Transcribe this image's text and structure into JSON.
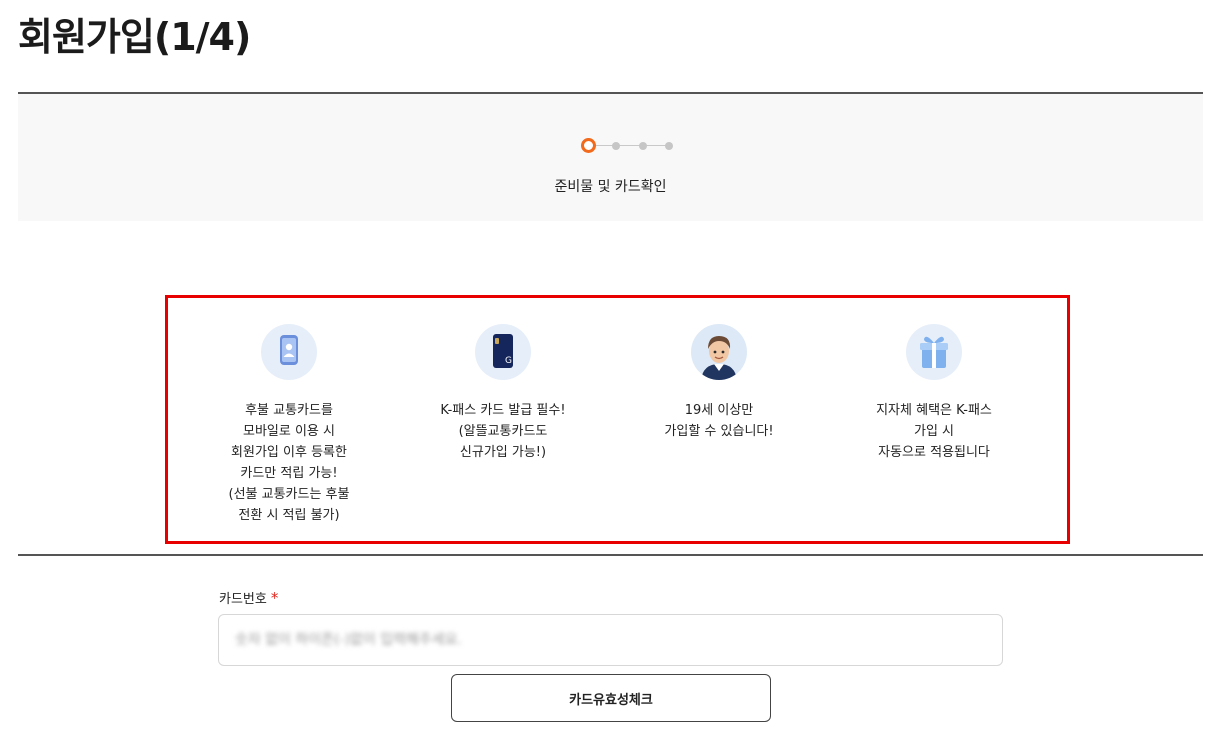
{
  "page": {
    "title": "회원가입(1/4)"
  },
  "stepper": {
    "total_steps": 4,
    "current_step": 1,
    "current_label": "준비물 및 카드확인"
  },
  "notices": [
    {
      "icon": "smartphone-icon",
      "lines": [
        "후불 교통카드를",
        "모바일로 이용 시",
        "회원가입 이후 등록한",
        "카드만 적립 가능!",
        "(선불 교통카드는 후불",
        "전환 시 적립 불가)"
      ]
    },
    {
      "icon": "transit-card-icon",
      "lines": [
        "K-패스 카드 발급 필수!",
        "(알뜰교통카드도",
        "신규가입 가능!)"
      ]
    },
    {
      "icon": "person-avatar-icon",
      "lines": [
        "19세 이상만",
        "가입할 수 있습니다!"
      ]
    },
    {
      "icon": "gift-box-icon",
      "lines": [
        "지자체 혜택은 K-패스",
        "가입 시",
        "자동으로 적용됩니다"
      ]
    }
  ],
  "card_form": {
    "label": "카드번호",
    "required_mark": "*",
    "placeholder": "숫자 없이 하이픈(-)없이 입력해주세요.",
    "value": ""
  },
  "validate_button": {
    "label": "카드유효성체크"
  },
  "colors": {
    "accent": "#f26a1b",
    "highlight_border": "#e80000",
    "required": "#e0251b"
  }
}
